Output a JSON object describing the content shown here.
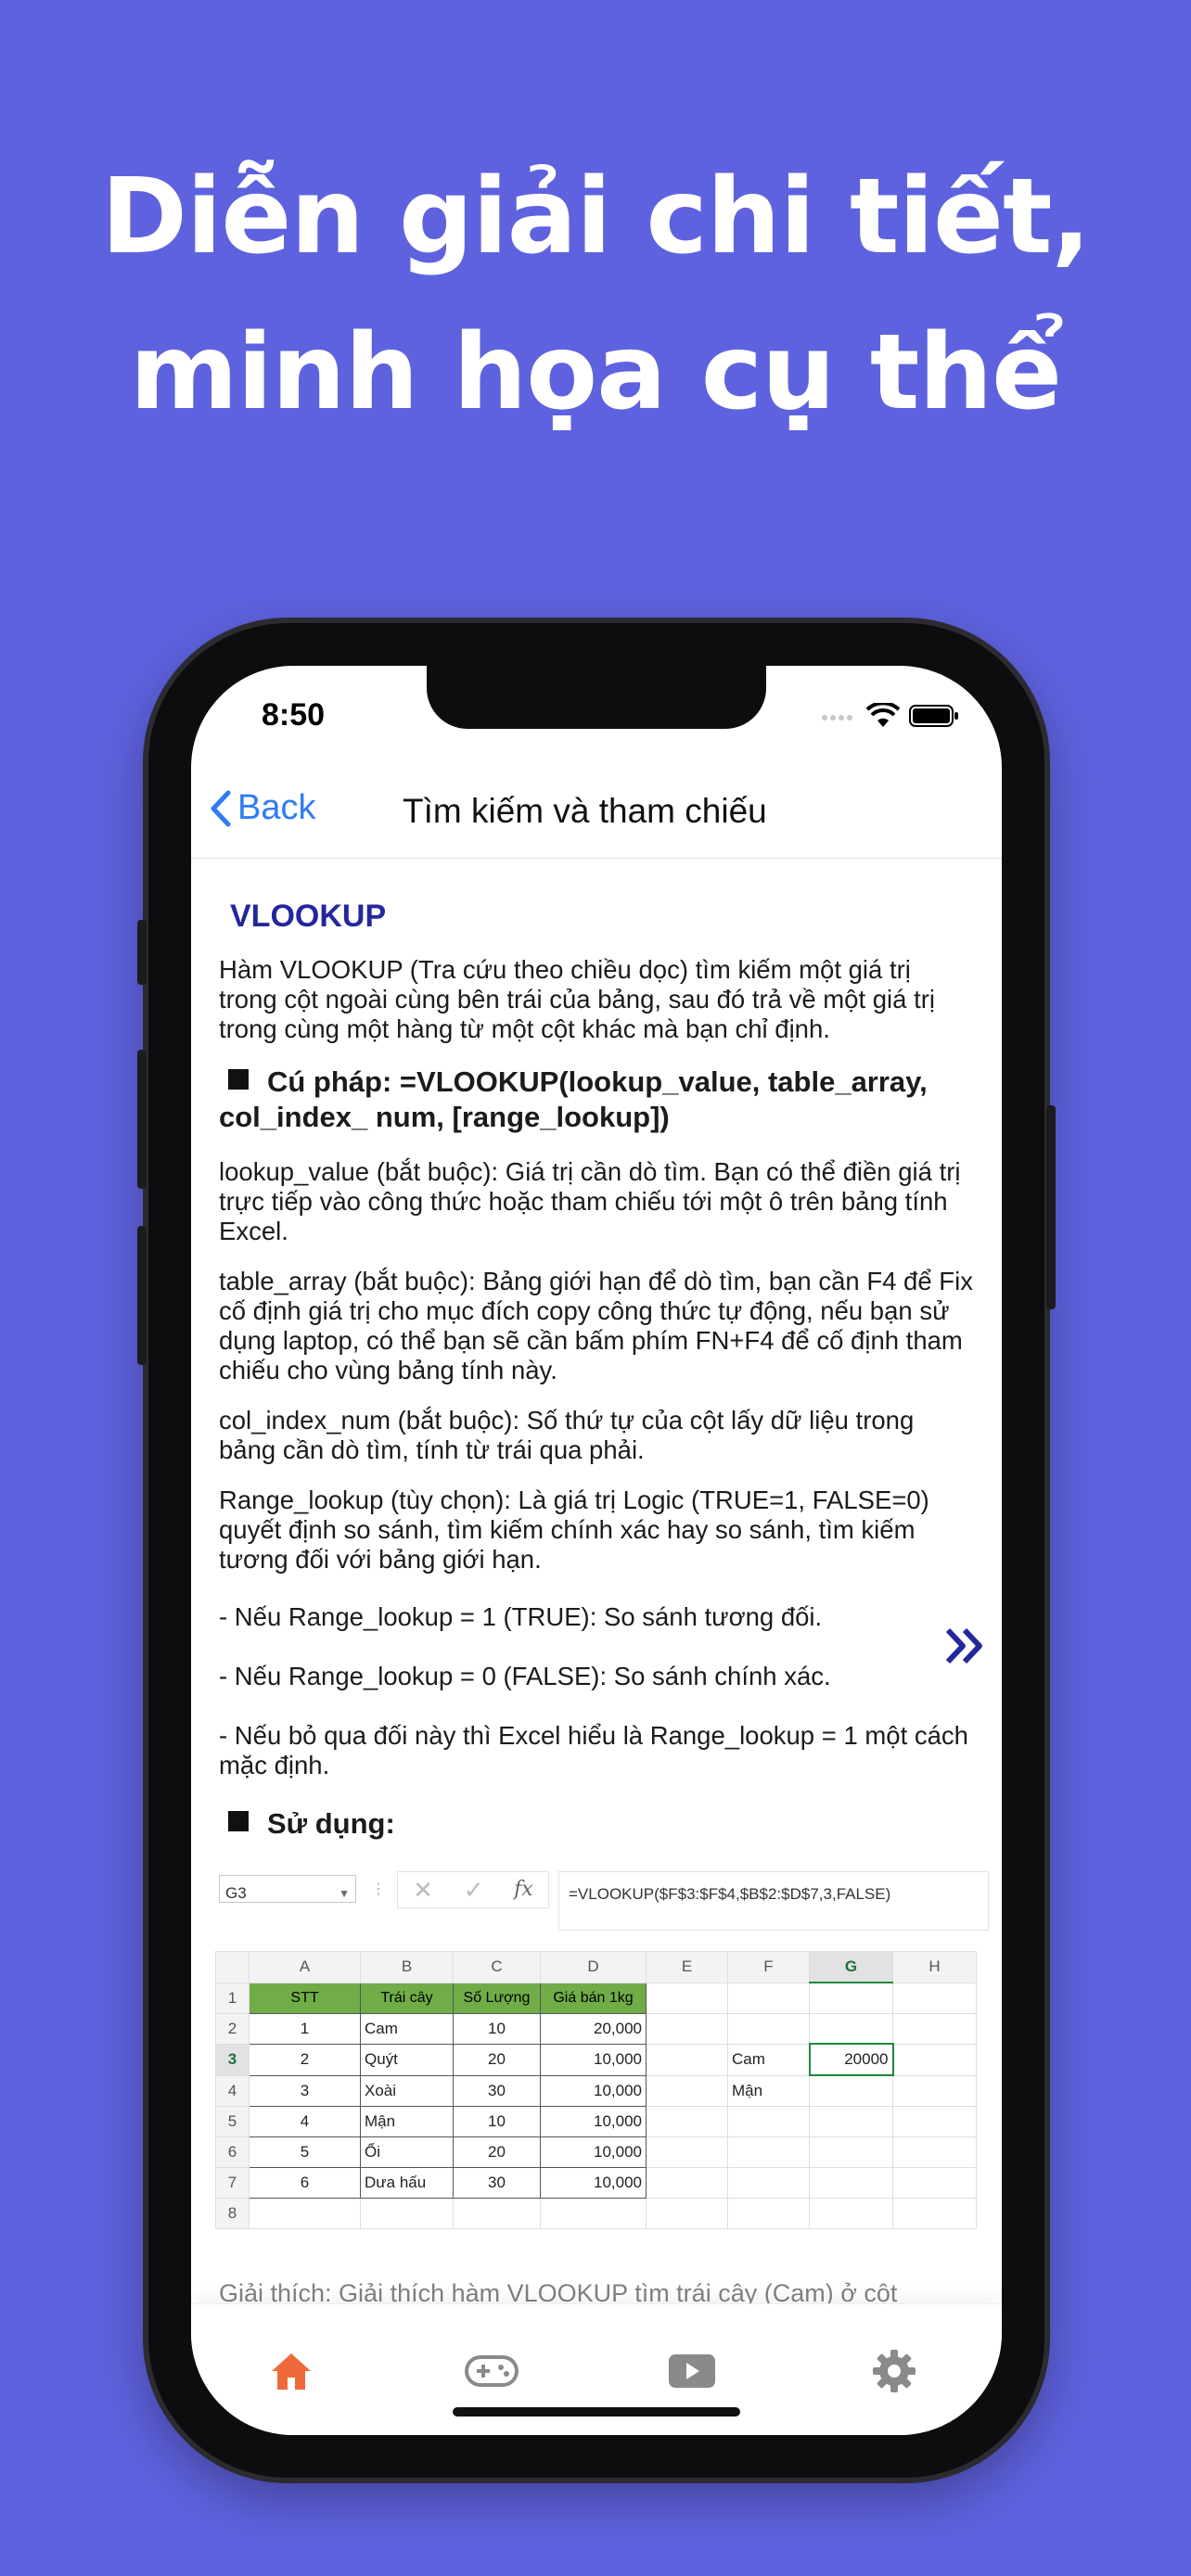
{
  "headline": {
    "line1": "Diễn giải chi tiết,",
    "line2": "minh họa cụ thể"
  },
  "status": {
    "time": "8:50"
  },
  "nav": {
    "back": "Back",
    "title": "Tìm kiếm và tham chiếu"
  },
  "article": {
    "title": "VLOOKUP",
    "intro": "Hàm VLOOKUP (Tra cứu theo chiều dọc) tìm kiếm một giá trị trong cột ngoài cùng bên trái của bảng, sau đó trả về một giá trị trong cùng một hàng từ một cột khác mà bạn chỉ định.",
    "syntax_heading": "Cú pháp: =VLOOKUP(lookup_value, table_array, col_index_ num, [range_lookup])",
    "params": [
      "lookup_value (bắt buộc): Giá trị cần dò tìm. Bạn có thể điền giá trị trực tiếp vào công thức hoặc tham chiếu tới một ô trên bảng tính Excel.",
      "table_array (bắt buộc): Bảng giới hạn để dò tìm, bạn cần F4 để Fix cố định giá trị cho mục đích copy công thức tự động, nếu bạn sử dụng laptop, có thể bạn sẽ cần bấm phím FN+F4 để cố định tham chiếu cho vùng bảng tính này.",
      "col_index_num (bắt buộc): Số thứ tự của cột lấy dữ liệu trong bảng cần dò tìm, tính từ trái qua phải.",
      "Range_lookup (tùy chọn): Là giá trị Logic (TRUE=1, FALSE=0) quyết định so sánh, tìm kiếm chính xác hay so sánh, tìm kiếm tương đối với bảng giới hạn.",
      "- Nếu Range_lookup = 1 (TRUE): So sánh tương đối.",
      "- Nếu Range_lookup = 0 (FALSE): So sánh chính xác.",
      "- Nếu bỏ qua đối này thì Excel hiểu là Range_lookup = 1 một cách mặc định."
    ],
    "usage_heading": "Sử dụng:",
    "peek": "Giải thích: Giải thích hàm VLOOKUP tìm trái cây (Cam) ở cột"
  },
  "sheet": {
    "namebox": "G3",
    "formula": "=VLOOKUP($F$3:$F$4,$B$2:$D$7,3,FALSE)",
    "columns": [
      "A",
      "B",
      "C",
      "D",
      "E",
      "F",
      "G",
      "H"
    ],
    "headers": [
      "STT",
      "Trái cây",
      "Số Lượng",
      "Giá bán 1kg"
    ],
    "rows": [
      [
        "1",
        "Cam",
        "10",
        "20,000"
      ],
      [
        "2",
        "Quýt",
        "20",
        "10,000"
      ],
      [
        "3",
        "Xoài",
        "30",
        "10,000"
      ],
      [
        "4",
        "Mận",
        "10",
        "10,000"
      ],
      [
        "5",
        "Ổi",
        "20",
        "10,000"
      ],
      [
        "6",
        "Dưa hấu",
        "30",
        "10,000"
      ]
    ],
    "row_numbers": [
      "1",
      "2",
      "3",
      "4",
      "5",
      "6",
      "7",
      "8"
    ],
    "lookup_f3": "Cam",
    "lookup_f4": "Mận",
    "result_g3": "20000"
  },
  "tabs": [
    {
      "name": "home",
      "color": "#ef6a3a"
    },
    {
      "name": "games",
      "color": "#8a8a8a"
    },
    {
      "name": "videos",
      "color": "#8a8a8a"
    },
    {
      "name": "settings",
      "color": "#8a8a8a"
    }
  ],
  "colors": {
    "background": "#5f62df",
    "accent": "#24279c",
    "link": "#2f7cf6",
    "active_tab": "#ef6a3a"
  }
}
